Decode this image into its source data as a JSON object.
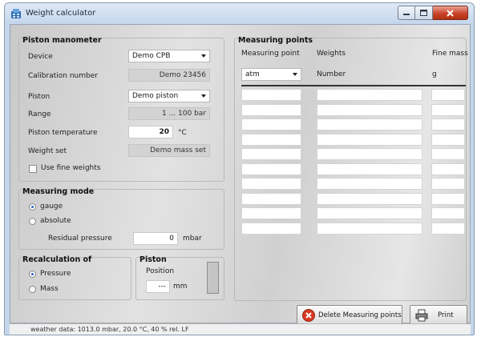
{
  "window": {
    "title": "Weight calculator"
  },
  "piston_manometer": {
    "title": "Piston manometer",
    "device_label": "Device",
    "device_value": "Demo CPB",
    "calibration_label": "Calibration number",
    "calibration_value": "Demo 23456",
    "piston_label": "Piston",
    "piston_value": "Demo piston",
    "range_label": "Range",
    "range_value": "1 ... 100 bar",
    "temperature_label": "Piston temperature",
    "temperature_value": "20",
    "temperature_unit": "°C",
    "weight_set_label": "Weight set",
    "weight_set_value": "Demo mass set",
    "fine_weights_label": "Use fine weights",
    "fine_weights_checked": false
  },
  "measuring_mode": {
    "title": "Measuring mode",
    "gauge_label": "gauge",
    "absolute_label": "absolute",
    "selected": "gauge",
    "residual_label": "Residual pressure",
    "residual_value": "0",
    "residual_unit": "mbar"
  },
  "recalculation": {
    "title": "Recalculation of",
    "pressure_label": "Pressure",
    "mass_label": "Mass",
    "selected": "Pressure"
  },
  "piston_box": {
    "title": "Piston",
    "position_label": "Position",
    "position_value": "---",
    "position_unit": "mm"
  },
  "measuring_points": {
    "title": "Measuring points",
    "col_point": "Measuring point",
    "col_weights": "Weights",
    "col_fine": "Fine mass",
    "point_select": "atm",
    "weights_sub": "Number",
    "fine_sub": "g",
    "rows": 10
  },
  "buttons": {
    "delete_label": "Delete Measuring points",
    "print_label": "Print"
  },
  "status": {
    "text": "weather data: 1013.0 mbar, 20.0 °C, 40 % rel. LF"
  },
  "icons": {
    "app": "calculator-app-icon",
    "delete": "red-x-icon",
    "print": "printer-icon"
  },
  "colors": {
    "delete_icon": "#d63a24",
    "title_gradient_top": "#dfe9f5",
    "close_button": "#c9432a"
  }
}
